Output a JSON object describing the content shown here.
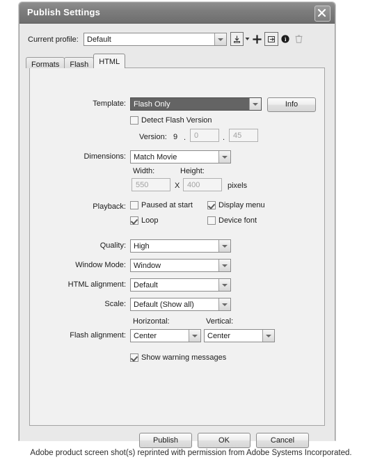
{
  "window": {
    "title": "Publish Settings",
    "close_icon": "close-icon"
  },
  "profile": {
    "label": "Current profile:",
    "value": "Default",
    "tools": [
      {
        "name": "profile-import-icon",
        "label": "Import profile",
        "disabled": false
      },
      {
        "name": "profile-add-icon",
        "label": "Create new profile",
        "disabled": false
      },
      {
        "name": "profile-duplicate-icon",
        "label": "Duplicate profile",
        "disabled": false
      },
      {
        "name": "profile-properties-icon",
        "label": "Profile properties",
        "disabled": false
      },
      {
        "name": "profile-delete-icon",
        "label": "Delete profile",
        "disabled": true
      }
    ]
  },
  "tabs": [
    {
      "label": "Formats",
      "active": false
    },
    {
      "label": "Flash",
      "active": false
    },
    {
      "label": "HTML",
      "active": true
    }
  ],
  "form": {
    "template": {
      "label": "Template:",
      "value": "Flash Only",
      "info_button": "Info"
    },
    "detect_flash_version": {
      "label": "Detect Flash Version",
      "checked": false
    },
    "version": {
      "label": "Version:",
      "major": "9",
      "minor": "0",
      "build": "45",
      "separator": "."
    },
    "dimensions": {
      "label": "Dimensions:",
      "value": "Match Movie",
      "width_label": "Width:",
      "width_value": "550",
      "height_label": "Height:",
      "height_value": "400",
      "times_symbol": "X",
      "units": "pixels"
    },
    "playback": {
      "label": "Playback:",
      "options": [
        {
          "label": "Paused at start",
          "checked": false
        },
        {
          "label": "Display menu",
          "checked": true
        },
        {
          "label": "Loop",
          "checked": true
        },
        {
          "label": "Device font",
          "checked": false
        }
      ]
    },
    "quality": {
      "label": "Quality:",
      "value": "High"
    },
    "window_mode": {
      "label": "Window Mode:",
      "value": "Window"
    },
    "html_alignment": {
      "label": "HTML alignment:",
      "value": "Default"
    },
    "scale": {
      "label": "Scale:",
      "value": "Default (Show all)"
    },
    "flash_alignment": {
      "label": "Flash alignment:",
      "horizontal_label": "Horizontal:",
      "horizontal_value": "Center",
      "vertical_label": "Vertical:",
      "vertical_value": "Center"
    },
    "show_warning_messages": {
      "label": "Show warning messages",
      "checked": true
    }
  },
  "buttons": {
    "publish": "Publish",
    "ok": "OK",
    "cancel": "Cancel"
  },
  "caption": "Adobe product screen shot(s) reprinted with permission from Adobe Systems Incorporated.",
  "colors": {
    "titlebar": "#7d7d7d",
    "dialog_bg": "#e9e9e9",
    "panel_bg": "#f1f1f1",
    "selected_combo": "#646464",
    "disabled_text": "#a2a2a2"
  }
}
